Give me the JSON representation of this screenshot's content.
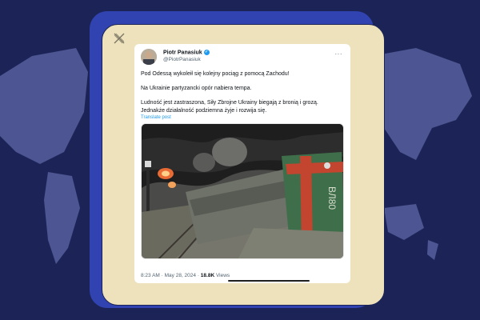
{
  "tweet": {
    "display_name": "Piotr Panasiuk",
    "handle": "@PiotrPanasiuk",
    "more": "···",
    "paragraph_1": "Pod Odessą wykoleił się kolejny pociąg z pomocą Zachodu!",
    "paragraph_2": "Na Ukrainie partyzancki opór nabiera tempa.",
    "paragraph_3_line_1": "Ludność jest zastraszona, Siły Zbrojne Ukrainy biegają z bronią i grozą.",
    "paragraph_3_line_2": "Jednakże działalność podziemna żyje i rozwija się.",
    "translate": "Translate post",
    "timestamp": "8:23 AM · May 28, 2024 · ",
    "views_count": "18.8K",
    "views_label": " Views",
    "locomotive_marking": "ВЛ80"
  },
  "colors": {
    "background": "#1c2457",
    "card_blue": "#3143b0",
    "card_cream": "#ede2bb",
    "link": "#1d9bf0"
  },
  "icons": {
    "close": "x-cross-icon",
    "verified": "verified-badge-icon",
    "more": "more-options-icon"
  }
}
